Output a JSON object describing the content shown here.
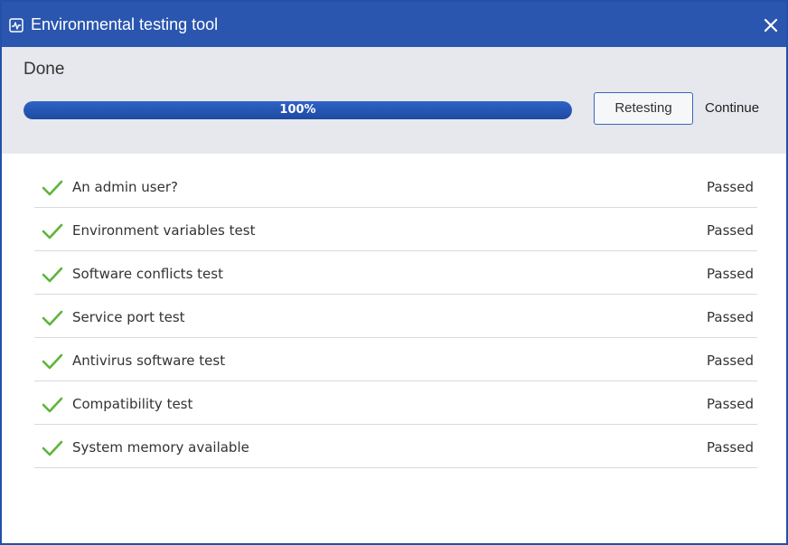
{
  "window": {
    "title": "Environmental testing tool",
    "title_icon": "activity-monitor-icon",
    "close_icon": "close-icon",
    "accent_color": "#2a56b0"
  },
  "header": {
    "status": "Done",
    "progress_percent": 100,
    "progress_label": "100%",
    "retest_label": "Retesting",
    "continue_label": "Continue"
  },
  "tests": [
    {
      "name": "An admin user?",
      "status": "Passed",
      "icon": "check-icon"
    },
    {
      "name": "Environment variables test",
      "status": "Passed",
      "icon": "check-icon"
    },
    {
      "name": "Software conflicts test",
      "status": "Passed",
      "icon": "check-icon"
    },
    {
      "name": "Service port test",
      "status": "Passed",
      "icon": "check-icon"
    },
    {
      "name": "Antivirus software test",
      "status": "Passed",
      "icon": "check-icon"
    },
    {
      "name": "Compatibility test",
      "status": "Passed",
      "icon": "check-icon"
    },
    {
      "name": "System memory available",
      "status": "Passed",
      "icon": "check-icon"
    }
  ],
  "colors": {
    "check": "#5cb53a",
    "titlebar": "#2a56b0",
    "progress": "#2456b4"
  }
}
